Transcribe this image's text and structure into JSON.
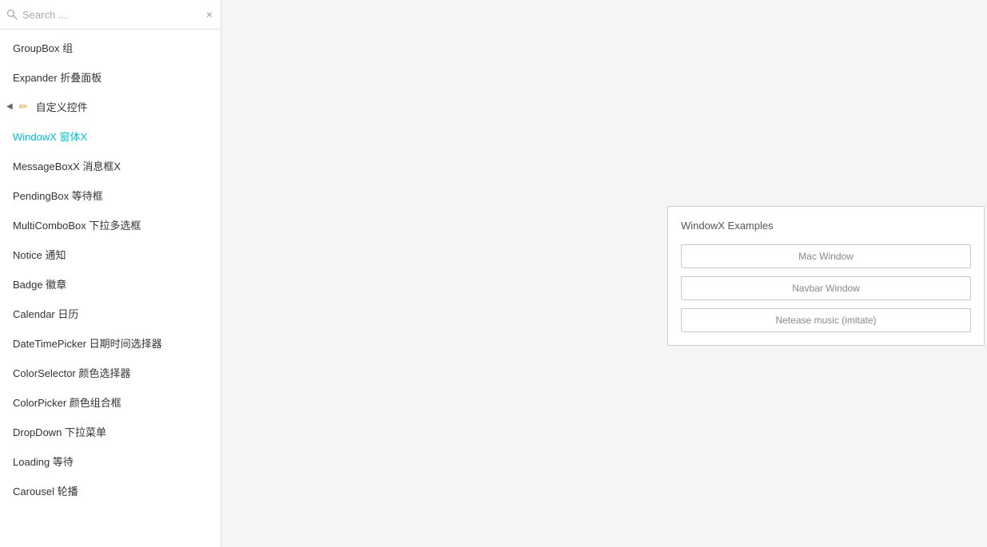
{
  "search": {
    "placeholder": "Search ...",
    "clear_icon": "×"
  },
  "sidebar": {
    "items": [
      {
        "id": "groupbox",
        "label": "GroupBox 组",
        "active": false,
        "is_section": false
      },
      {
        "id": "expander",
        "label": "Expander 折叠面板",
        "active": false,
        "is_section": false
      },
      {
        "id": "custom-controls",
        "label": "自定义控件",
        "active": false,
        "is_section": true
      },
      {
        "id": "windowx",
        "label": "WindowX 窗体X",
        "active": true,
        "is_section": false
      },
      {
        "id": "messageboxX",
        "label": "MessageBoxX 消息框X",
        "active": false,
        "is_section": false
      },
      {
        "id": "pendingbox",
        "label": "PendingBox 等待框",
        "active": false,
        "is_section": false
      },
      {
        "id": "multicombobox",
        "label": "MultiComboBox 下拉多选框",
        "active": false,
        "is_section": false
      },
      {
        "id": "notice",
        "label": "Notice 通知",
        "active": false,
        "is_section": false
      },
      {
        "id": "badge",
        "label": "Badge 徽章",
        "active": false,
        "is_section": false
      },
      {
        "id": "calendar",
        "label": "Calendar 日历",
        "active": false,
        "is_section": false
      },
      {
        "id": "datetimepicker",
        "label": "DateTimePicker 日期时间选择器",
        "active": false,
        "is_section": false
      },
      {
        "id": "colorselector",
        "label": "ColorSelector 颜色选择器",
        "active": false,
        "is_section": false
      },
      {
        "id": "colorpicker",
        "label": "ColorPicker 颜色组合框",
        "active": false,
        "is_section": false
      },
      {
        "id": "dropdown",
        "label": "DropDown 下拉菜单",
        "active": false,
        "is_section": false
      },
      {
        "id": "loading",
        "label": "Loading 等待",
        "active": false,
        "is_section": false
      },
      {
        "id": "carousel",
        "label": "Carousel 轮播",
        "active": false,
        "is_section": false
      }
    ]
  },
  "windowx_panel": {
    "title": "WindowX Examples",
    "buttons": [
      {
        "id": "mac-window",
        "label": "Mac Window"
      },
      {
        "id": "navbar-window",
        "label": "Navbar Window"
      },
      {
        "id": "netease-window",
        "label": "Netease music (imitate)"
      }
    ]
  }
}
